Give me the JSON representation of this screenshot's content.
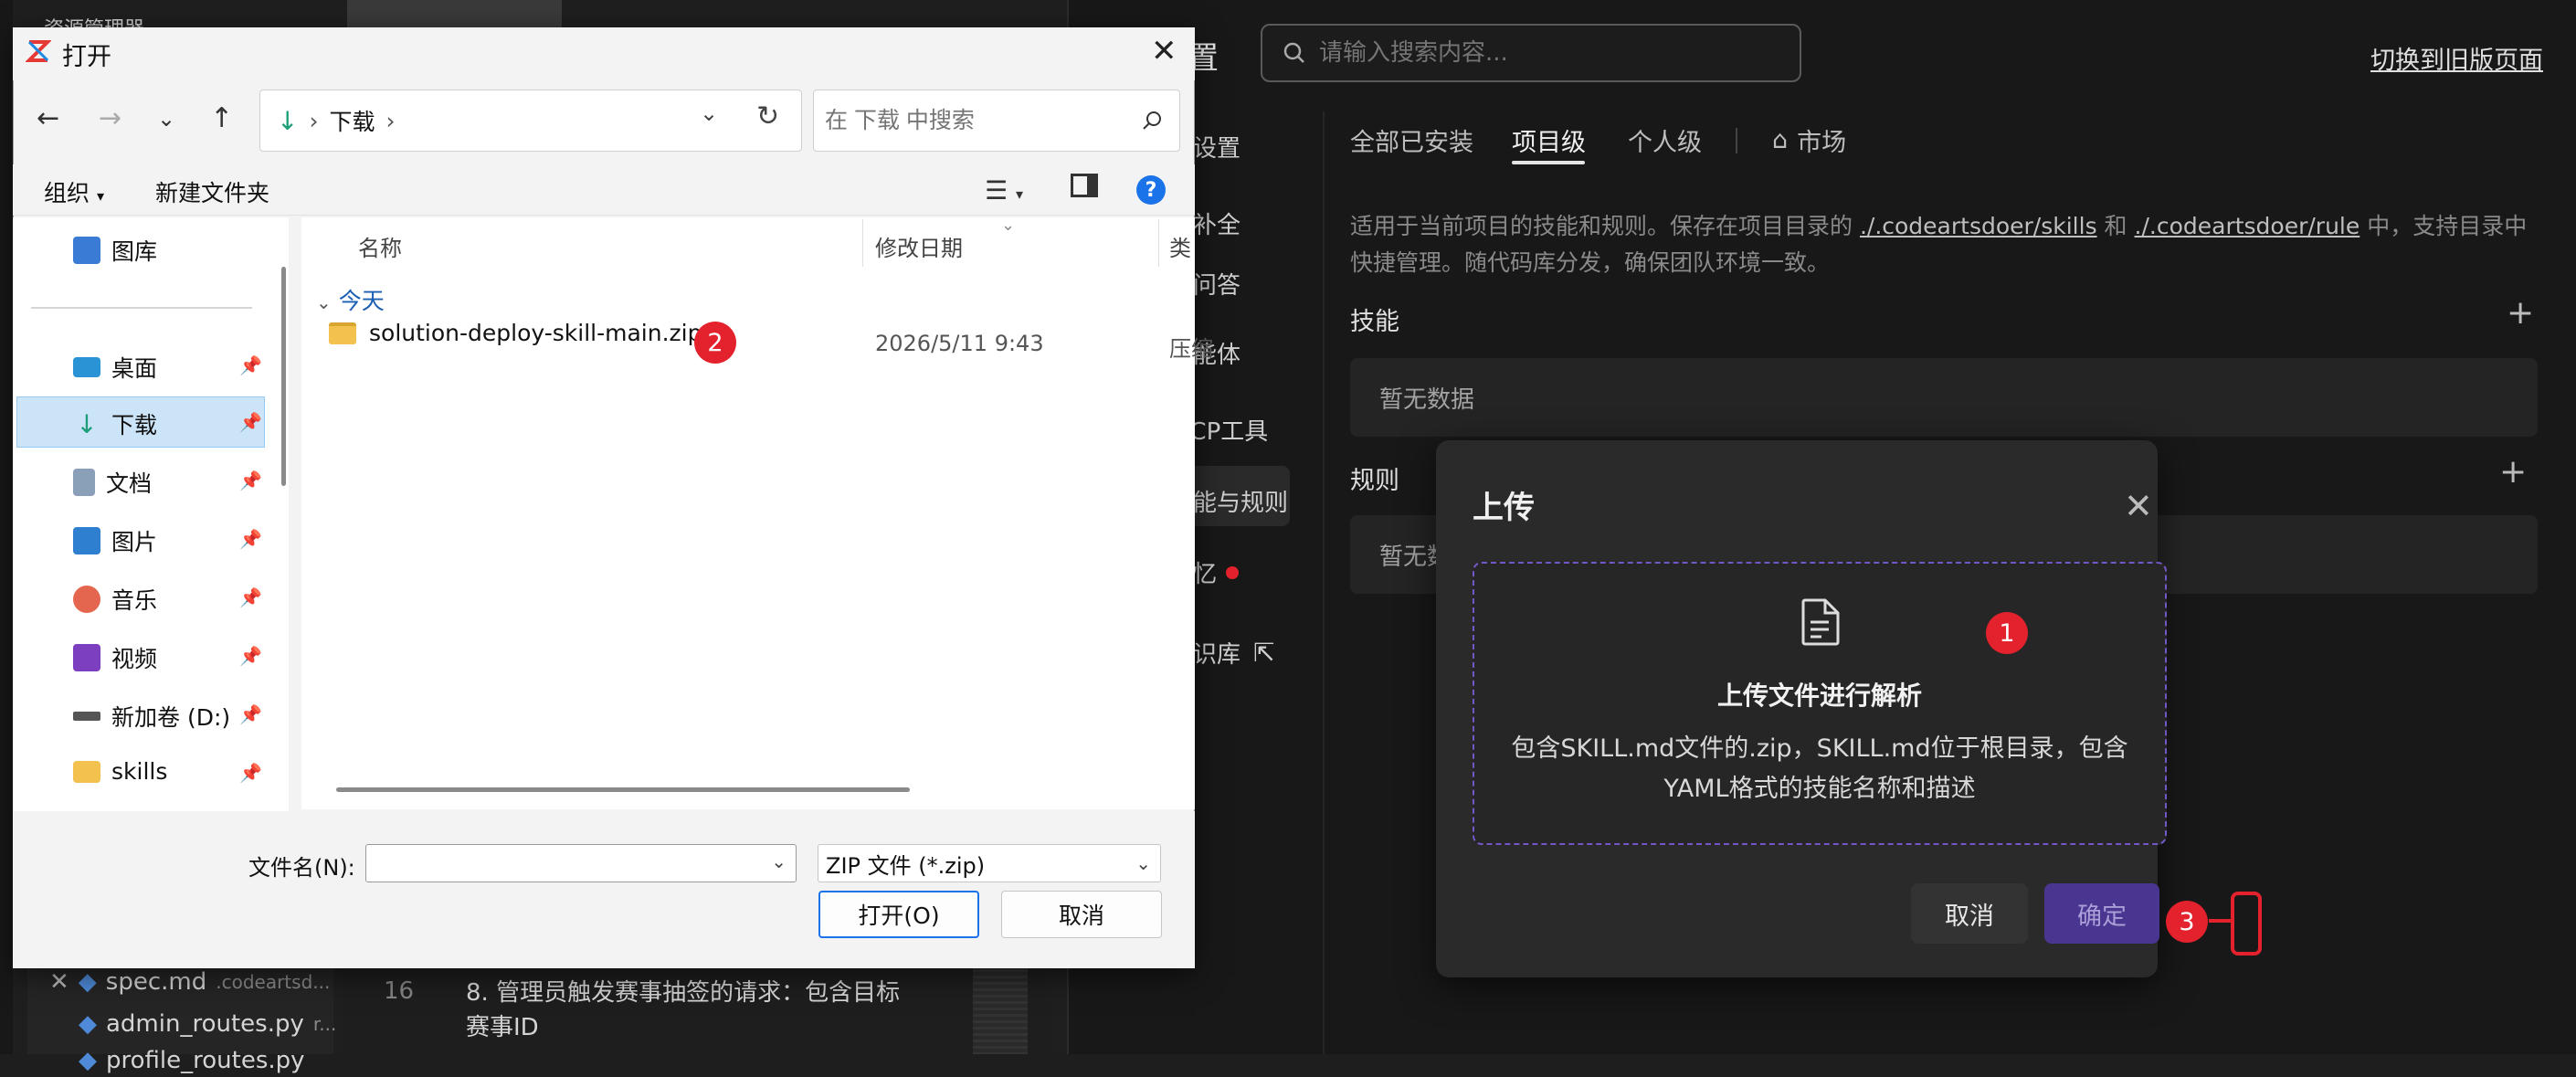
{
  "background_ide": {
    "explorer_title": "资源管理器",
    "files": [
      {
        "name": "spec.md",
        "path": ".codeartsd..."
      },
      {
        "name": "admin_routes.py",
        "path": "r..."
      },
      {
        "name": "profile_routes.py",
        "path": ""
      }
    ],
    "line_number": "16",
    "code_line_1": "8. 管理员触发赛事抽签的请求：包含目标",
    "code_line_2": "赛事ID"
  },
  "settings": {
    "title": "置",
    "search_placeholder": "请输入搜索内容...",
    "switch_link": "切换到旧版页面",
    "left_nav": [
      "用设置",
      "码补全",
      "技问答",
      "智能体",
      "MCP工具",
      "技能与规则",
      "记忆",
      "知识库"
    ],
    "tabs": [
      "全部已安装",
      "项目级",
      "个人级",
      "市场"
    ],
    "description_prefix": "适用于当前项目的技能和规则。保存在项目目录的 ",
    "path_skills": "./.codeartsdoer/skills",
    "description_and": " 和 ",
    "path_rules": "./.codeartsdoer/rule",
    "description_suffix": " 中，支持目录中快捷管理。随代码库分发，确保团队环境一致。",
    "skills_title": "技能",
    "rules_title": "规则",
    "empty_text": "暂无数据",
    "rules_empty_partial": "暂无数"
  },
  "upload_modal": {
    "title": "上传",
    "drop_title": "上传文件进行解析",
    "drop_desc": "包含SKILL.md文件的.zip，SKILL.md位于根目录，包含YAML格式的技能名称和描述",
    "cancel": "取消",
    "ok": "确定"
  },
  "badges": {
    "b1": "1",
    "b2": "2",
    "b3": "3"
  },
  "open_dialog": {
    "title": "打开",
    "address": "下载",
    "search_placeholder": "在 下载 中搜索",
    "organize": "组织",
    "new_folder": "新建文件夹",
    "nav": {
      "gallery": "图库",
      "desktop": "桌面",
      "downloads": "下载",
      "documents": "文档",
      "pictures": "图片",
      "music": "音乐",
      "videos": "视频",
      "drive_d": "新加卷 (D:)",
      "skills": "skills"
    },
    "columns": {
      "name": "名称",
      "date": "修改日期",
      "type": "类"
    },
    "group": "今天",
    "file": {
      "name": "solution-deploy-skill-main.zip",
      "date": "2026/5/11 9:43",
      "type": "压缩"
    },
    "filename_label": "文件名(N):",
    "filetype": "ZIP 文件 (*.zip)",
    "open_button": "打开(O)",
    "cancel_button": "取消"
  },
  "colors": {
    "accent_purple": "#7357c7",
    "badge_red": "#e3222d",
    "win_blue": "#1a73e8"
  }
}
